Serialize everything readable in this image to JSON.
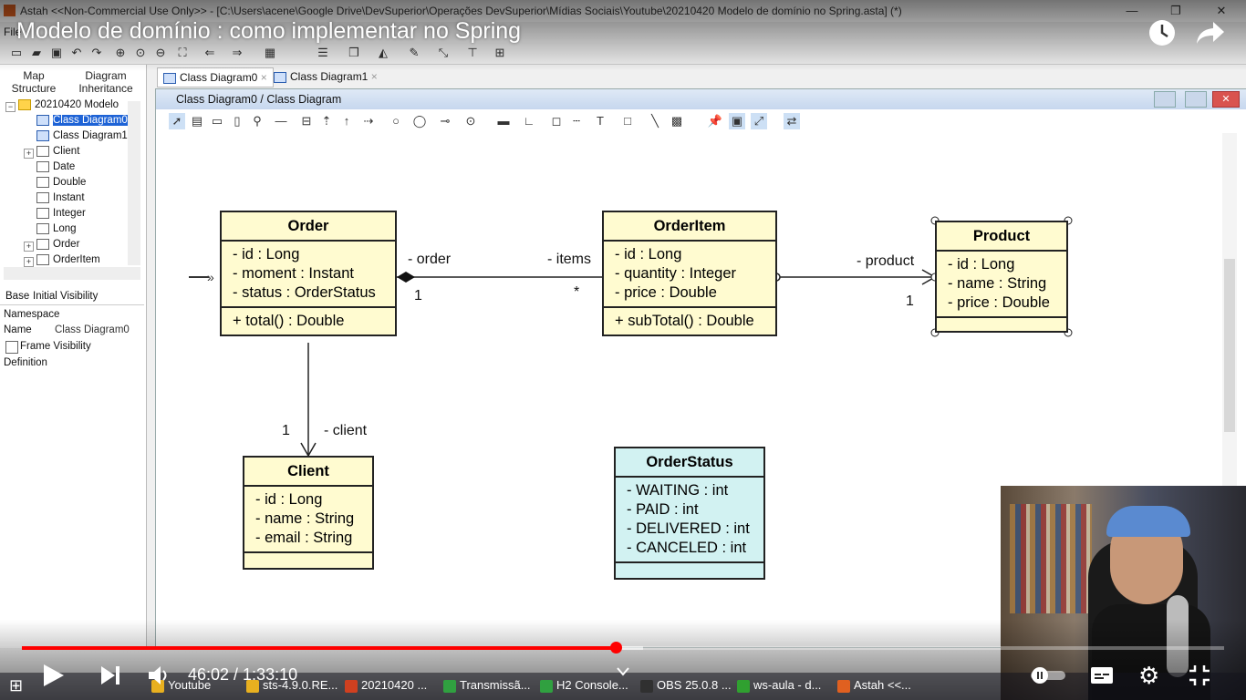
{
  "window": {
    "title": "Astah  <<Non-Commercial Use Only>>  - [C:\\Users\\acene\\Google Drive\\DevSuperior\\Operações DevSuperior\\Mídias Sociais\\Youtube\\20210420 Modelo de domínio no Spring.asta] (*)",
    "minimize": "—",
    "restore": "❐",
    "close": "✕"
  },
  "video": {
    "title": "Modelo de domínio : como implementar no Spring",
    "clock_icon": "clock-icon",
    "share_icon": "share-icon",
    "time": "46:02 / 1:33:10",
    "progress": 0.494,
    "accent": "#ff0000"
  },
  "menu": {
    "file": "File"
  },
  "left_panel": {
    "tabs": [
      "Map Structure",
      "Diagram Inheritance"
    ],
    "tree": [
      {
        "label": "20210420 Modelo",
        "icon": "folder"
      },
      {
        "label": "Class Diagram0",
        "icon": "diagram",
        "selected": true
      },
      {
        "label": "Class Diagram1",
        "icon": "diagram"
      },
      {
        "label": "Client",
        "icon": "class"
      },
      {
        "label": "Date",
        "icon": "class"
      },
      {
        "label": "Double",
        "icon": "class"
      },
      {
        "label": "Instant",
        "icon": "class"
      },
      {
        "label": "Integer",
        "icon": "class"
      },
      {
        "label": "Long",
        "icon": "class"
      },
      {
        "label": "Order",
        "icon": "class"
      },
      {
        "label": "OrderItem",
        "icon": "class"
      }
    ],
    "props_tabs": [
      "Base",
      "Initial Visibility"
    ],
    "namespace_label": "Namespace",
    "name_label": "Name",
    "name_value": "Class Diagram0",
    "frame_visibility": "Frame Visibility",
    "definition": "Definition"
  },
  "diagram_tabs": [
    "Class Diagram0",
    "Class Diagram1"
  ],
  "frame_title": "Class Diagram0 / Class Diagram",
  "classes": {
    "order": {
      "name": "Order",
      "attrs": [
        "- id : Long",
        "- moment : Instant",
        "- status : OrderStatus"
      ],
      "ops": [
        "+ total() : Double"
      ]
    },
    "orderitem": {
      "name": "OrderItem",
      "attrs": [
        "- id : Long",
        "- quantity : Integer",
        "- price : Double"
      ],
      "ops": [
        "+ subTotal() : Double"
      ]
    },
    "product": {
      "name": "Product",
      "attrs": [
        "- id : Long",
        "- name : String",
        "- price : Double"
      ],
      "ops": []
    },
    "client": {
      "name": "Client",
      "attrs": [
        "- id : Long",
        "- name : String",
        "- email : String"
      ],
      "ops": []
    },
    "orderstatus": {
      "name": "OrderStatus",
      "attrs": [
        "- WAITING : int",
        "- PAID : int",
        "- DELIVERED : int",
        "- CANCELED : int"
      ],
      "ops": []
    }
  },
  "associations": {
    "order_role": "- order",
    "order_mult": "1",
    "items_role": "- items",
    "items_mult": "*",
    "product_role": "- product",
    "product_mult": "1",
    "client_role": "- client",
    "client_mult": "1"
  },
  "taskbar": [
    {
      "label": "Youtube",
      "color": "#e8b020"
    },
    {
      "label": "sts-4.9.0.RE...",
      "color": "#e8b020"
    },
    {
      "label": "20210420 ...",
      "color": "#d04020"
    },
    {
      "label": "Transmissã...",
      "color": "#30a040"
    },
    {
      "label": "H2 Console...",
      "color": "#30a040"
    },
    {
      "label": "OBS 25.0.8 ...",
      "color": "#303030"
    },
    {
      "label": "ws-aula - d...",
      "color": "#30a030"
    },
    {
      "label": "Astah  <<...",
      "color": "#e06020"
    }
  ]
}
